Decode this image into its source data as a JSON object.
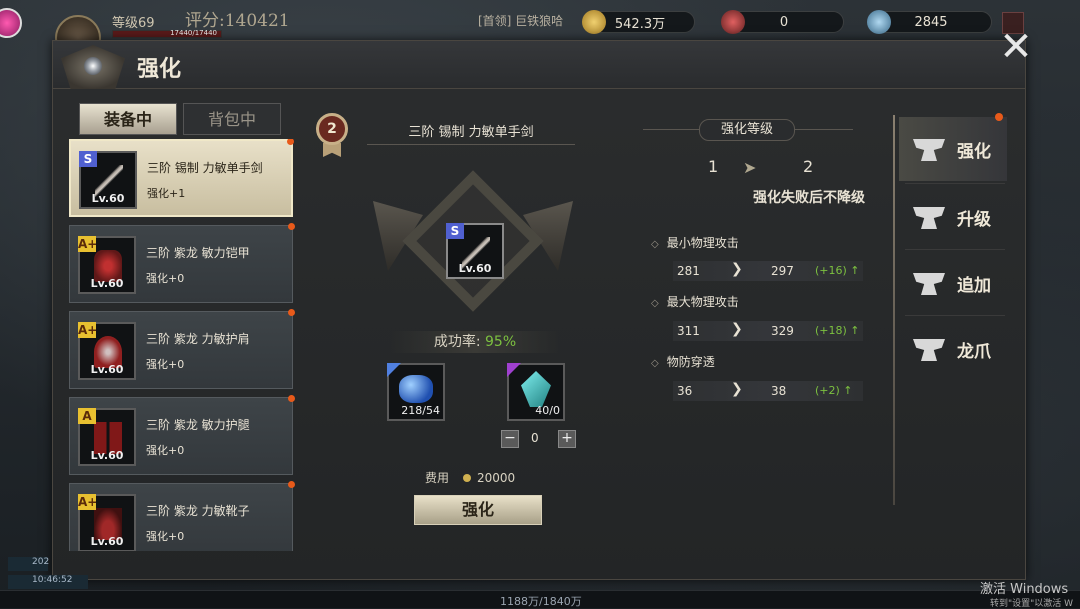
{
  "hud": {
    "level": "等级69",
    "score": "评分:140421",
    "hp": "17440/17440",
    "guild": "[首领] 巨铁狼哈",
    "gold": "542.3万",
    "red_currency": "0",
    "crystal": "2845"
  },
  "panel": {
    "title": "强化",
    "close_icon": "close-icon"
  },
  "tabs": {
    "equipped": "装备中",
    "bag": "背包中"
  },
  "equipment": [
    {
      "name": "三阶 锡制 力敏单手剑",
      "level": "Lv.60",
      "enhance": "强化+1",
      "grade": "S",
      "selected": true
    },
    {
      "name": "三阶 紫龙 敏力铠甲",
      "level": "Lv.60",
      "enhance": "强化+0",
      "grade": "A+"
    },
    {
      "name": "三阶 紫龙 力敏护肩",
      "level": "Lv.60",
      "enhance": "强化+0",
      "grade": "A+"
    },
    {
      "name": "三阶 紫龙 敏力护腿",
      "level": "Lv.60",
      "enhance": "强化+0",
      "grade": "A"
    },
    {
      "name": "三阶 紫龙 力敏靴子",
      "level": "Lv.60",
      "enhance": "强化+0",
      "grade": "A+"
    }
  ],
  "center": {
    "rank": "2",
    "item_title": "三阶 锡制 力敏单手剑",
    "item_level": "Lv.60",
    "item_grade": "S",
    "success_label": "成功率:",
    "success_rate": "95%",
    "material1_count": "218/54",
    "material2_count": "40/0",
    "stepper_value": "0",
    "cost_label": "费用",
    "cost_value": "20000",
    "enhance_button": "强化"
  },
  "stats": {
    "header": "强化等级",
    "from_level": "1",
    "to_level": "2",
    "note": "强化失败后不降级",
    "rows": [
      {
        "label": "最小物理攻击",
        "from": "281",
        "to": "297",
        "diff": "(+16)"
      },
      {
        "label": "最大物理攻击",
        "from": "311",
        "to": "329",
        "diff": "(+18)"
      },
      {
        "label": "物防穿透",
        "from": "36",
        "to": "38",
        "diff": "(+2)"
      }
    ]
  },
  "nav": [
    {
      "label": "强化",
      "active": true
    },
    {
      "label": "升级"
    },
    {
      "label": "追加"
    },
    {
      "label": "龙爪"
    }
  ],
  "bottom": {
    "date": "202",
    "time": "10:46:52",
    "xp": "1188万/1840万",
    "watermark1": "激活 Windows",
    "watermark2": "转到\"设置\"以激活 W"
  }
}
